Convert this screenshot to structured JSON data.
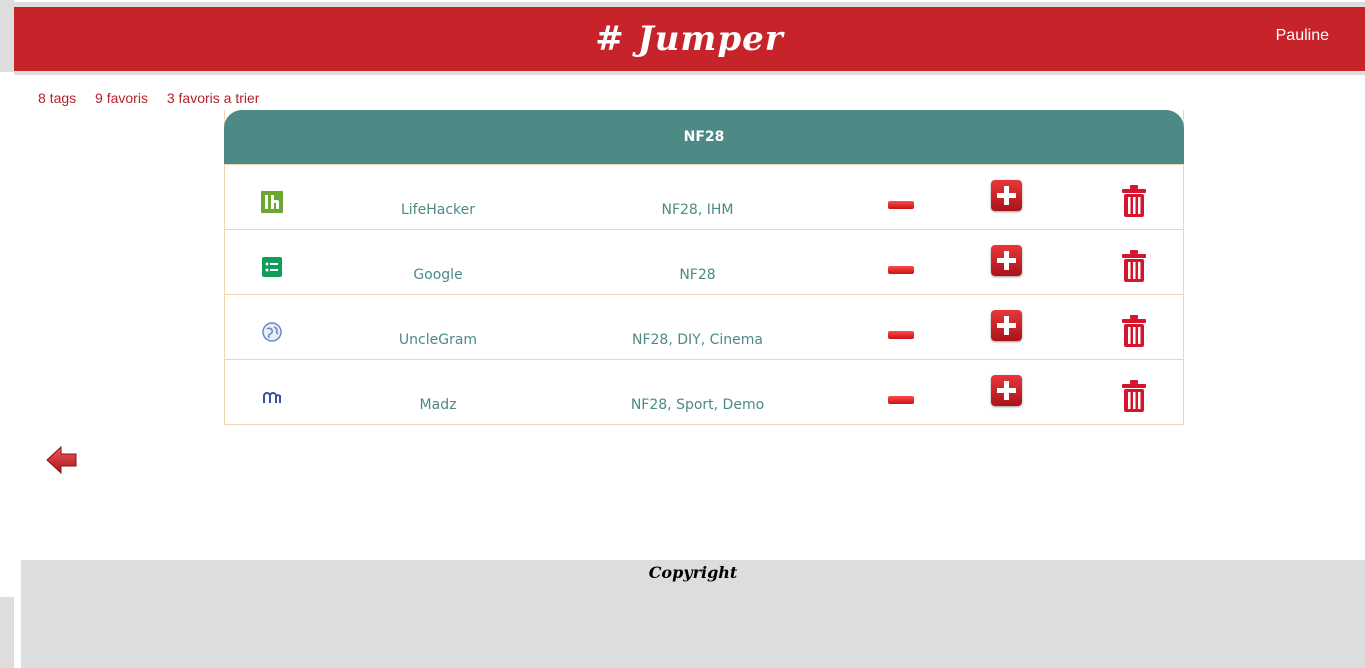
{
  "header": {
    "logo": "# Jumper",
    "user": "Pauline"
  },
  "stats": {
    "tags": "8 tags",
    "favoris": "9 favoris",
    "to_sort": "3 favoris a trier"
  },
  "panel": {
    "title": "NF28",
    "rows": [
      {
        "icon": "lifehacker-icon",
        "name": "LifeHacker",
        "tags": "NF28, IHM"
      },
      {
        "icon": "google-forms-icon",
        "name": "Google",
        "tags": "NF28"
      },
      {
        "icon": "globe-icon",
        "name": "UncleGram",
        "tags": "NF28, DIY, Cinema"
      },
      {
        "icon": "madz-icon",
        "name": "Madz",
        "tags": "NF28, Sport, Demo"
      }
    ]
  },
  "footer": {
    "copyright": "Copyright"
  },
  "colors": {
    "header_red": "#c7232b",
    "teal": "#4d8a86",
    "link_red": "#b5222a"
  }
}
